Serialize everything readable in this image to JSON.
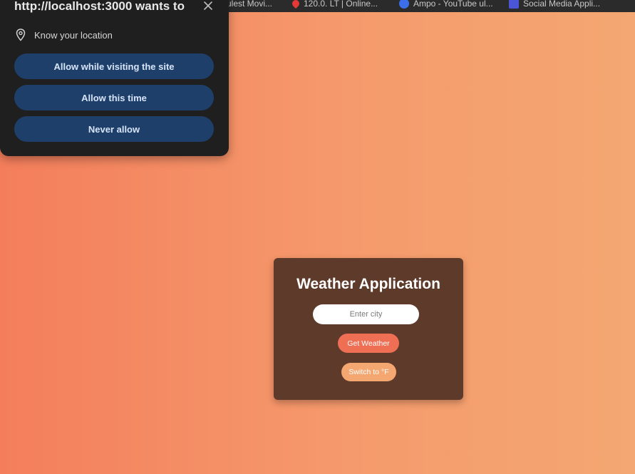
{
  "bookmarks": [
    {
      "label": "ulest Movi..."
    },
    {
      "label": "120.0. LT | Online...",
      "icon": "pin-icon",
      "color": "#e53935"
    },
    {
      "label": "Ampo - YouTube ul...",
      "icon": "circle-icon",
      "color": "#3b6ee8"
    },
    {
      "label": "Social Media Appli...",
      "icon": "square-icon",
      "color": "#4a56d6"
    }
  ],
  "permission_popup": {
    "title": "http://localhost:3000 wants to",
    "close_icon": "close-icon",
    "request_icon": "location-pin-icon",
    "request_text": "Know your location",
    "buttons": {
      "allow_visit": "Allow while visiting the site",
      "allow_once": "Allow this time",
      "never": "Never allow"
    },
    "button_color": "#1f3f6b",
    "background_color": "#1f1f20"
  },
  "weather_app": {
    "title": "Weather Application",
    "city_placeholder": "Enter city",
    "city_value": "",
    "get_weather_label": "Get Weather",
    "switch_unit_label": "Switch to °F",
    "card_color": "#5e3a2b",
    "get_weather_color": "#ef6f55",
    "switch_color": "#f4a771"
  },
  "background_gradient": [
    "#f47e5c",
    "#f4a772"
  ]
}
